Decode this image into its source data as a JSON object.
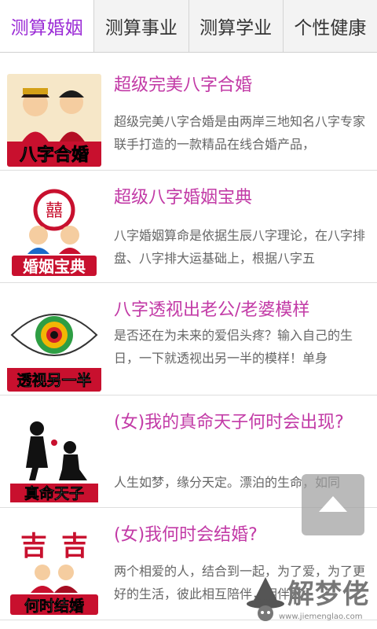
{
  "tabs": [
    {
      "label": "测算婚姻",
      "active": true
    },
    {
      "label": "测算事业",
      "active": false
    },
    {
      "label": "测算学业",
      "active": false
    },
    {
      "label": "个性健康",
      "active": false
    }
  ],
  "items": [
    {
      "title": "超级完美八字合婚",
      "desc": "超级完美八字合婚是由两岸三地知名八字专家联手打造的一款精品在线合婚产品，",
      "thumb_text": "八字合婚"
    },
    {
      "title": "超级八字婚姻宝典",
      "desc": "八字婚姻算命是依据生辰八字理论，在八字排盘、八字排大运基础上，根据八字五",
      "thumb_text": "婚姻宝典"
    },
    {
      "title": "八字透视出老公/老婆模样",
      "desc": "是否还在为未来的爱侣头疼？输入自己的生日，一下就透视出另一半的模样！单身",
      "thumb_text": "透视另一半"
    },
    {
      "title": "(女)我的真命天子何时会出现?",
      "desc": "人生如梦，缘分天定。漂泊的生命，如同",
      "thumb_text": "真命天子"
    },
    {
      "title": "(女)我何时会结婚?",
      "desc": "两个相爱的人，结合到一起，为了爱，为了更好的生活，彼此相互陪伴，相伴永",
      "thumb_text": "何时结婚"
    }
  ],
  "watermark": {
    "text": "解梦佬",
    "url": "www.jiemenglao.com"
  },
  "icons": {
    "scroll_top": "arrow-up-icon",
    "watermark_logo": "wizard-hat-icon"
  },
  "colors": {
    "accent": "#9b2bd6",
    "title": "#c23aa6",
    "banner": "#c8102e"
  }
}
